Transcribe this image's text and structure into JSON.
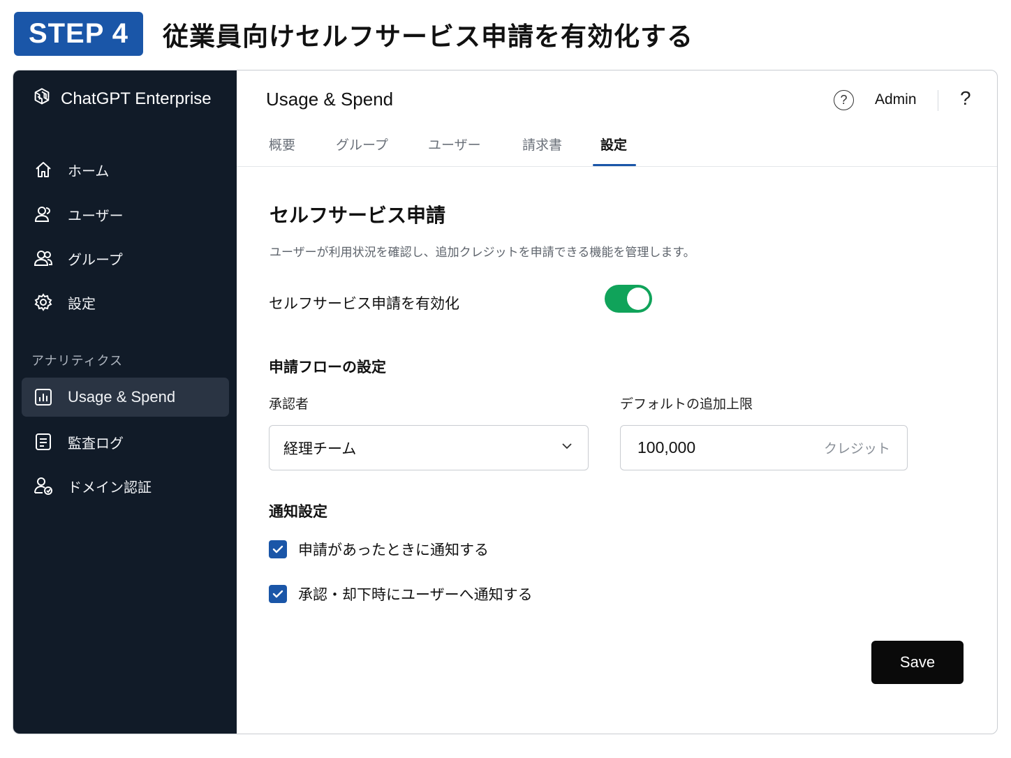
{
  "banner": {
    "step": "STEP 4",
    "title": "従業員向けセルフサービス申請を有効化する"
  },
  "sidebar": {
    "brand": "ChatGPT Enterprise",
    "nav": [
      {
        "label": "ホーム",
        "icon": "home-icon"
      },
      {
        "label": "ユーザー",
        "icon": "user-icon"
      },
      {
        "label": "グループ",
        "icon": "group-icon"
      },
      {
        "label": "設定",
        "icon": "gear-icon"
      }
    ],
    "section_label": "アナリティクス",
    "analytics": [
      {
        "label": "Usage & Spend",
        "icon": "bar-chart-icon",
        "active": true
      },
      {
        "label": "監査ログ",
        "icon": "document-icon"
      },
      {
        "label": "ドメイン認証",
        "icon": "user-verify-icon"
      }
    ]
  },
  "topbar": {
    "title": "Usage & Spend",
    "help": "?",
    "admin": "Admin",
    "help_plain": "?"
  },
  "tabs": [
    {
      "label": "概要"
    },
    {
      "label": "グループ"
    },
    {
      "label": "ユーザー"
    },
    {
      "label": "請求書"
    },
    {
      "label": "設定",
      "active": true
    }
  ],
  "content": {
    "section_title": "セルフサービス申請",
    "section_desc": "ユーザーが利用状況を確認し、追加クレジットを申請できる機能を管理します。",
    "toggle_label": "セルフサービス申請を有効化",
    "toggle_on": true,
    "flow_title": "申請フローの設定",
    "approver_label": "承認者",
    "approver_value": "経理チーム",
    "limit_label": "デフォルトの追加上限",
    "limit_value": "100,000",
    "limit_unit": "クレジット",
    "notify_title": "通知設定",
    "checks": [
      {
        "label": "申請があったときに通知する",
        "checked": true
      },
      {
        "label": "承認・却下時にユーザーへ通知する",
        "checked": true
      }
    ],
    "save": "Save"
  },
  "colors": {
    "accent": "#1a56a8",
    "toggle_on": "#10a35a",
    "sidebar_bg": "#111b28",
    "sidebar_active": "#2a3443",
    "save_bg": "#0a0a0a"
  }
}
